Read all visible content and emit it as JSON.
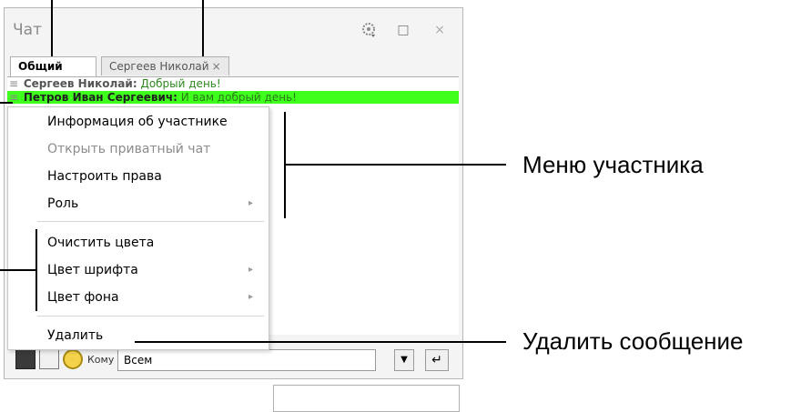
{
  "window": {
    "title": "Чат",
    "tabs": [
      {
        "label": "Общий"
      },
      {
        "label": "Сергеев Николай",
        "close": "×"
      }
    ],
    "buttons": {
      "maximize": "□",
      "close": "×"
    }
  },
  "messages": [
    {
      "author": "Сергеев Николай:",
      "text": " Добрый день!"
    },
    {
      "author": "Петров Иван Сергеевич:",
      "text": " И вам добрый день!"
    }
  ],
  "context_menu": {
    "items": [
      {
        "label": "Информация об участнике",
        "enabled": true
      },
      {
        "label": "Открыть приватный чат",
        "enabled": false
      },
      {
        "label": "Настроить права",
        "enabled": true
      },
      {
        "label": "Роль",
        "enabled": true,
        "submenu": true
      },
      {
        "label": "Очистить цвета",
        "enabled": true
      },
      {
        "label": "Цвет шрифта",
        "enabled": true,
        "submenu": true
      },
      {
        "label": "Цвет фона",
        "enabled": true,
        "submenu": true
      },
      {
        "label": "Удалить",
        "enabled": true
      }
    ],
    "submenu_arrow": "▸"
  },
  "bottom_bar": {
    "to_label": "Кому",
    "recipient": "Всем",
    "dropdown_arrow": "▼",
    "send_icon": "↵"
  },
  "annotations": {
    "member_menu": "Меню участника",
    "delete_message": "Удалить сообщение"
  },
  "colors": {
    "highlight_row": "#3fff1c",
    "message_text": "#2e8a1e"
  }
}
